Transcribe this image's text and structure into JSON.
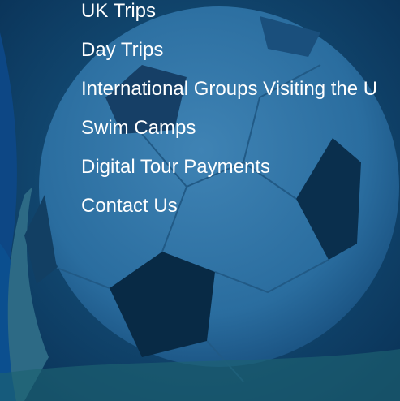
{
  "menu": {
    "items": [
      {
        "label": "UK Trips"
      },
      {
        "label": "Day Trips"
      },
      {
        "label": "International Groups Visiting the U"
      },
      {
        "label": "Swim Camps"
      },
      {
        "label": "Digital Tour Payments"
      },
      {
        "label": "Contact Us"
      }
    ]
  },
  "colors": {
    "overlay": "#0c3d66",
    "link_text": "#ffffff"
  }
}
